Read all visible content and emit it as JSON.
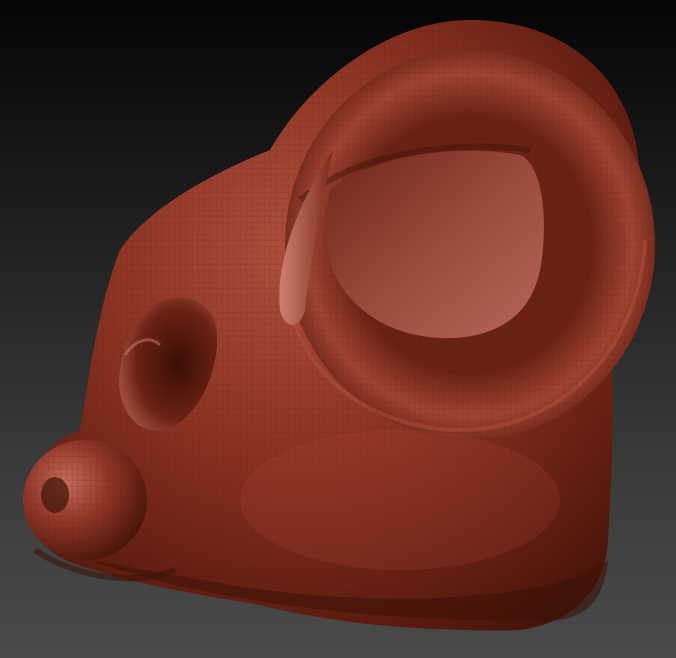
{
  "scene": {
    "subject": "sculpted-ram-head",
    "colors": {
      "background_top": "#050505",
      "background_bottom": "#4a4a4a",
      "clay_base": "#8a3222",
      "clay_highlight": "#c46a5a",
      "clay_shadow": "#3e1208",
      "wire_line": "#5a1a10"
    }
  }
}
